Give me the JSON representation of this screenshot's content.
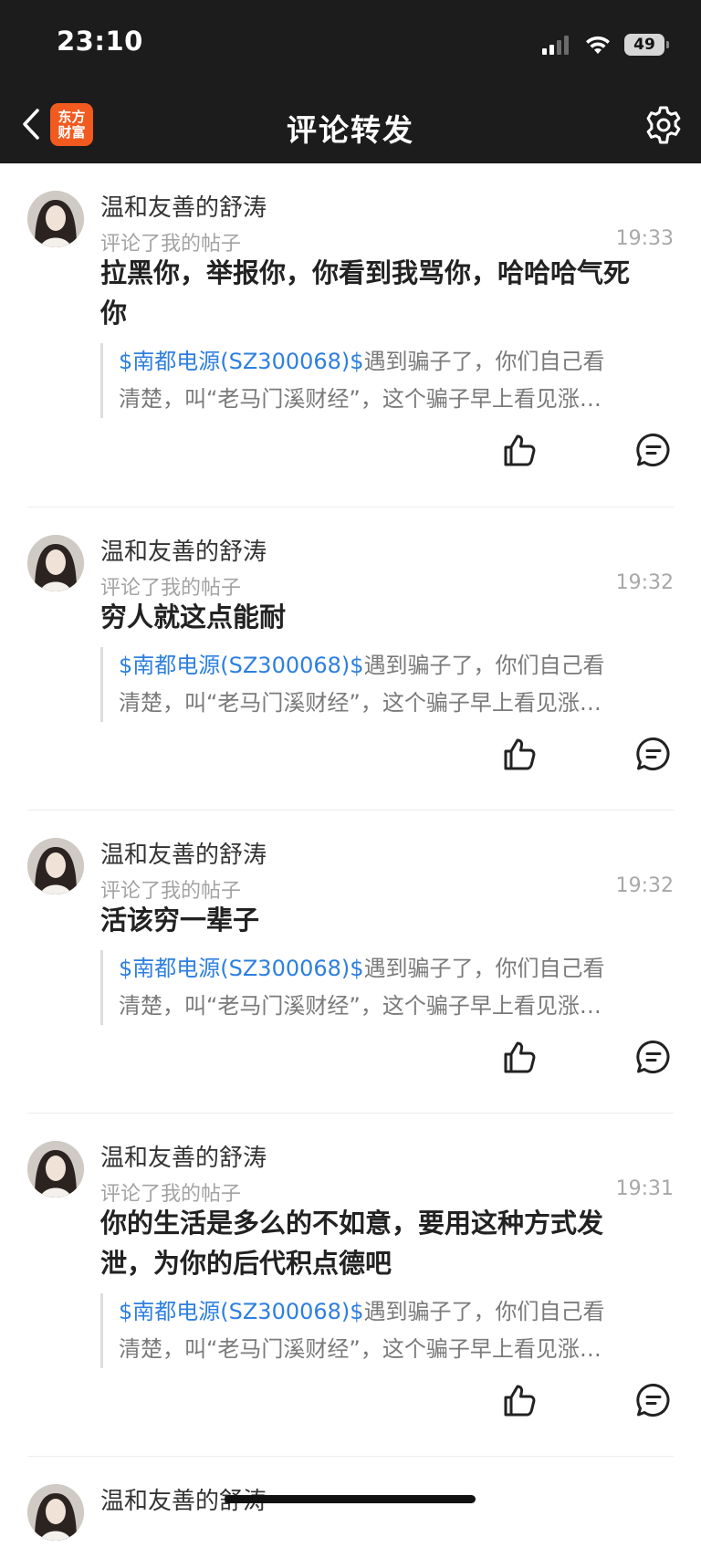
{
  "status_bar": {
    "time": "23:10",
    "battery": "49"
  },
  "nav": {
    "title": "评论转发",
    "logo_line1": "东方",
    "logo_line2": "财富",
    "logo_color": "#f25a1f"
  },
  "colors": {
    "accent_link": "#2d7fe0",
    "header_bg": "#1c1c1c"
  },
  "comments": [
    {
      "username": "温和友善的舒涛",
      "action": "评论了我的帖子",
      "time": "19:33",
      "text": "拉黑你，举报你，你看到我骂你，哈哈哈气死你",
      "quote_stock": "$南都电源(SZ300068)$",
      "quote_line1_rest": "遇到骗子了，你们自己看",
      "quote_line2": "清楚，叫“老马门溪财经”，这个骗子早上看见涨…"
    },
    {
      "username": "温和友善的舒涛",
      "action": "评论了我的帖子",
      "time": "19:32",
      "text": "穷人就这点能耐",
      "quote_stock": "$南都电源(SZ300068)$",
      "quote_line1_rest": "遇到骗子了，你们自己看",
      "quote_line2": "清楚，叫“老马门溪财经”，这个骗子早上看见涨…"
    },
    {
      "username": "温和友善的舒涛",
      "action": "评论了我的帖子",
      "time": "19:32",
      "text": "活该穷一辈子",
      "quote_stock": "$南都电源(SZ300068)$",
      "quote_line1_rest": "遇到骗子了，你们自己看",
      "quote_line2": "清楚，叫“老马门溪财经”，这个骗子早上看见涨…"
    },
    {
      "username": "温和友善的舒涛",
      "action": "评论了我的帖子",
      "time": "19:31",
      "text": "你的生活是多么的不如意，要用这种方式发泄，为你的后代积点德吧",
      "quote_stock": "$南都电源(SZ300068)$",
      "quote_line1_rest": "遇到骗子了，你们自己看",
      "quote_line2": "清楚，叫“老马门溪财经”，这个骗子早上看见涨…"
    },
    {
      "username": "温和友善的舒涛"
    }
  ]
}
